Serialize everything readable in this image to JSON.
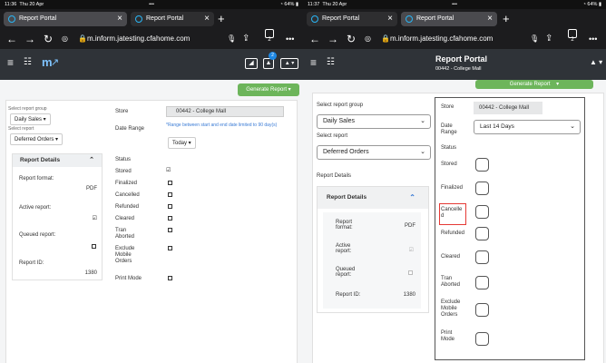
{
  "left": {
    "status": {
      "time": "11:36",
      "date": "Thu 20 Apr",
      "dots": "•••",
      "battery": "64%"
    },
    "tabs": [
      {
        "label": "Report Portal",
        "close": "×"
      },
      {
        "label": "Report Portal",
        "close": "×"
      }
    ],
    "new_tab": "+",
    "url": "m.inform.jatesting.cfahome.com",
    "tab_count": "2",
    "more": "•••",
    "notification_count": "2",
    "generate_label": "Generate Report",
    "report_group_label": "Select report group",
    "report_group_value": "Daily Sales",
    "report_label": "Select report",
    "report_value": "Deferred Orders",
    "details": {
      "title": "Report Details",
      "format_label": "Report format:",
      "format_value": "PDF",
      "active_label": "Active report:",
      "queued_label": "Queued report:",
      "id_label": "Report ID:",
      "id_value": "1380"
    },
    "form": {
      "store_label": "Store",
      "store_value": "00442 - College Mall",
      "date_label": "Date Range",
      "note": "*Range between start and end date limited to 90 day(s)",
      "date_value": "Today",
      "status_label": "Status",
      "stored": "Stored",
      "finalized": "Finalized",
      "cancelled": "Cancelled",
      "refunded": "Refunded",
      "cleared": "Cleared",
      "tran_aborted": "Tran Aborted",
      "exclude": "Exclude Mobile Orders",
      "print_mode": "Print Mode"
    }
  },
  "right": {
    "status": {
      "time": "11:37",
      "date": "Thu 20 Apr",
      "dots": "•••",
      "battery": "64%"
    },
    "tabs": [
      {
        "label": "Report Portal",
        "close": "×"
      },
      {
        "label": "Report Portal",
        "close": "×"
      }
    ],
    "new_tab": "+",
    "url": "m.inform.jatesting.cfahome.com",
    "tab_count": "2",
    "more": "•••",
    "title": "Report Portal",
    "subtitle": "00442 - College Mall",
    "generate_label": "Generate Report",
    "report_group_label": "Select report group",
    "report_group_value": "Daily Sales",
    "report_label": "Select report",
    "report_value": "Deferred Orders",
    "details_heading": "Report Details",
    "details": {
      "title": "Report Details",
      "format_label": "Report format:",
      "format_value": "PDF",
      "active_label": "Active report:",
      "queued_label": "Queued report:",
      "id_label": "Report ID:",
      "id_value": "1380"
    },
    "form": {
      "store_label": "Store",
      "store_value": "00442 - College Mall",
      "date_label": "Date Range",
      "date_value": "Last 14 Days",
      "status_label": "Status",
      "stored": "Stored",
      "finalized": "Finalized",
      "cancelled": "Cancelled",
      "refunded": "Refunded",
      "cleared": "Cleared",
      "tran_aborted": "Tran Aborted",
      "exclude": "Exclude Mobile Orders",
      "print_mode": "Print Mode"
    }
  },
  "colors": {
    "accent": "#6db55b",
    "header": "#2f3338",
    "highlight": "#e53935",
    "badge": "#1e88e5"
  }
}
